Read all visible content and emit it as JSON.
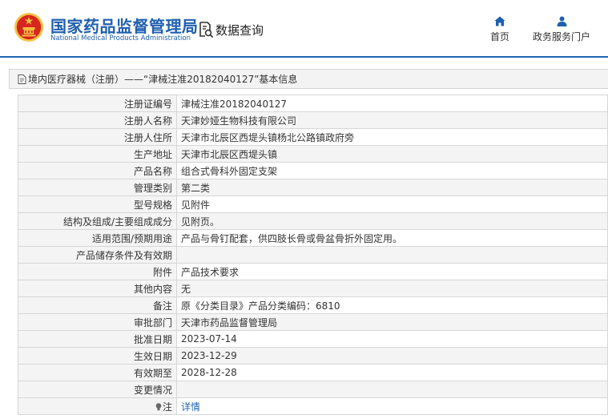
{
  "header": {
    "brand_cn": "国家药品监督管理局",
    "brand_en": "National Medical Products Administration",
    "query_label": "数据查询",
    "nav": {
      "home": "首页",
      "portal": "政务服务门户"
    }
  },
  "breadcrumb": "境内医疗器械（注册）——“津械注准20182040127”基本信息",
  "rows": [
    {
      "label": "注册证编号",
      "value": "津械注准20182040127"
    },
    {
      "label": "注册人名称",
      "value": "天津妙娅生物科技有限公司"
    },
    {
      "label": "注册人住所",
      "value": "天津市北辰区西堤头镇杨北公路镇政府旁"
    },
    {
      "label": "生产地址",
      "value": "天津市北辰区西堤头镇"
    },
    {
      "label": "产品名称",
      "value": "组合式骨科外固定支架"
    },
    {
      "label": "管理类别",
      "value": "第二类"
    },
    {
      "label": "型号规格",
      "value": "见附件"
    },
    {
      "label": "结构及组成/主要组成成分",
      "value": "见附页。"
    },
    {
      "label": "适用范围/预期用途",
      "value": "产品与骨钉配套，供四肢长骨或骨盆骨折外固定用。"
    },
    {
      "label": "产品储存条件及有效期",
      "value": ""
    },
    {
      "label": "附件",
      "value": "产品技术要求"
    },
    {
      "label": "其他内容",
      "value": "无"
    },
    {
      "label": "备注",
      "value": "原《分类目录》产品分类编码：6810"
    },
    {
      "label": "审批部门",
      "value": "天津市药品监督管理局"
    },
    {
      "label": "批准日期",
      "value": "2023-07-14"
    },
    {
      "label": "生效日期",
      "value": "2023-12-29"
    },
    {
      "label": "有效期至",
      "value": "2028-12-28"
    },
    {
      "label": "变更情况",
      "value": ""
    },
    {
      "label": "注",
      "value": "详情"
    }
  ],
  "colors": {
    "brand_blue": "#1f5fb0",
    "link_blue": "#1f64b3",
    "emblem_red": "#d7261e",
    "emblem_gold": "#f6c443"
  },
  "icons": [
    "national-emblem-icon",
    "data-query-icon",
    "home-icon",
    "user-icon",
    "document-icon",
    "lightbulb-icon"
  ]
}
